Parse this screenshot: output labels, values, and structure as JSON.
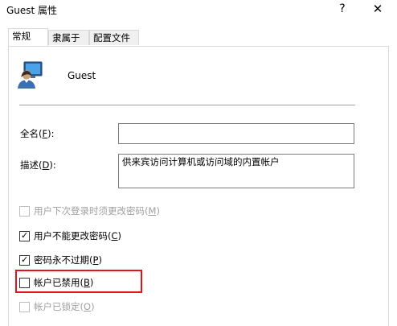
{
  "window": {
    "title": "Guest 属性",
    "help_glyph": "?",
    "close_glyph": "✕"
  },
  "tabs": [
    {
      "label": "常规",
      "active": true
    },
    {
      "label": "隶属于",
      "active": false
    },
    {
      "label": "配置文件",
      "active": false
    }
  ],
  "user": {
    "icon": "user-account-icon",
    "name": "Guest"
  },
  "fields": {
    "fullname": {
      "label_pre": "全名(",
      "accel": "F",
      "label_post": "):",
      "value": ""
    },
    "description": {
      "label_pre": "描述(",
      "accel": "D",
      "label_post": "):",
      "value": "供来宾访问计算机或访问域的内置帐户"
    }
  },
  "checkboxes": [
    {
      "label_pre": "用户下次登录时须更改密码(",
      "accel": "M",
      "label_post": ")",
      "checked": false,
      "enabled": false
    },
    {
      "label_pre": "用户不能更改密码(",
      "accel": "C",
      "label_post": ")",
      "checked": true,
      "enabled": true
    },
    {
      "label_pre": "密码永不过期(",
      "accel": "P",
      "label_post": ")",
      "checked": true,
      "enabled": true
    },
    {
      "label_pre": "帐户已禁用(",
      "accel": "B",
      "label_post": ")",
      "checked": false,
      "enabled": true
    },
    {
      "label_pre": "帐户已锁定(",
      "accel": "O",
      "label_post": ")",
      "checked": false,
      "enabled": false
    }
  ],
  "colors": {
    "highlight": "#e8101a",
    "disabled_text": "#a0a0a0"
  }
}
